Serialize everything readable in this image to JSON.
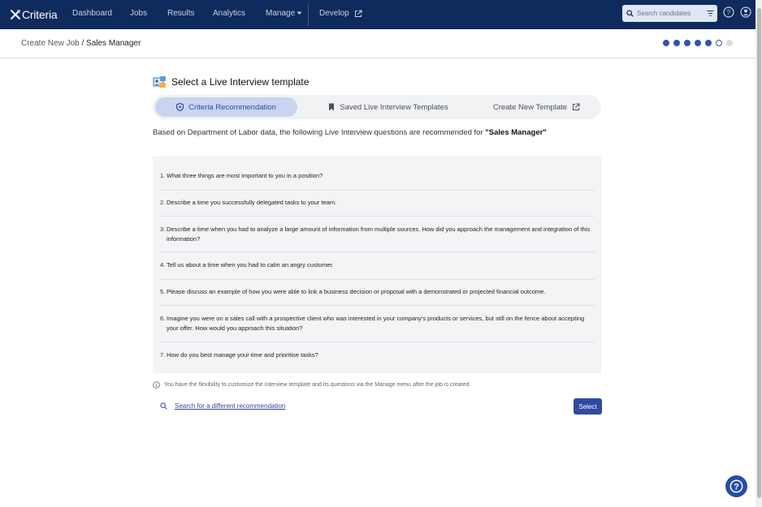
{
  "brand": {
    "name": "Criteria"
  },
  "nav": {
    "items": [
      "Dashboard",
      "Jobs",
      "Results",
      "Analytics",
      "Manage",
      "Develop"
    ]
  },
  "search": {
    "placeholder": "Search candidates"
  },
  "breadcrumb": {
    "root": "Create New Job",
    "separator": " / ",
    "current": "Sales Manager"
  },
  "progress": {
    "total_steps": 7,
    "completed_steps": 5,
    "current_step": 6
  },
  "page": {
    "title": "Select a Live Interview template",
    "tabs": [
      "Criteria Recommendation",
      "Saved Live Interview Templates",
      "Create New Template"
    ],
    "active_tab": "Criteria Recommendation",
    "intro_text": "Based on Department of Labor data, the following Live Interview questions are recommended for ",
    "intro_role": "\"Sales Manager\""
  },
  "questions": [
    {
      "num": "1.",
      "text": "What three things are most important to you in a position?"
    },
    {
      "num": "2.",
      "text": "Describe a time you successfully delegated tasks to your team."
    },
    {
      "num": "3.",
      "text": "Describe a time when you had to analyze a large amount of information from multiple sources. How did you approach the management and integration of this information?"
    },
    {
      "num": "4.",
      "text": "Tell us about a time when you had to calm an angry customer."
    },
    {
      "num": "5.",
      "text": "Please discuss an example of how you were able to link a business decision or proposal with a demonstrated or projected financial outcome."
    },
    {
      "num": "6.",
      "text": "Imagine you were on a sales call with a prospective client who was interested in your company's products or services, but still on the fence about accepting your offer. How would you approach this situation?"
    },
    {
      "num": "7.",
      "text": "How do you best manage your time and prioritise tasks?"
    }
  ],
  "footer": {
    "note": "You have the flexibility to customize the interview template and its questions via the Manage menu after the job is created.",
    "search_link": "Search for a different recommendation",
    "select_label": "Select"
  },
  "colors": {
    "nav_bg": "#0f2a5c",
    "accent": "#2f4aa0",
    "active_tab_bg": "#c9d5ef"
  }
}
